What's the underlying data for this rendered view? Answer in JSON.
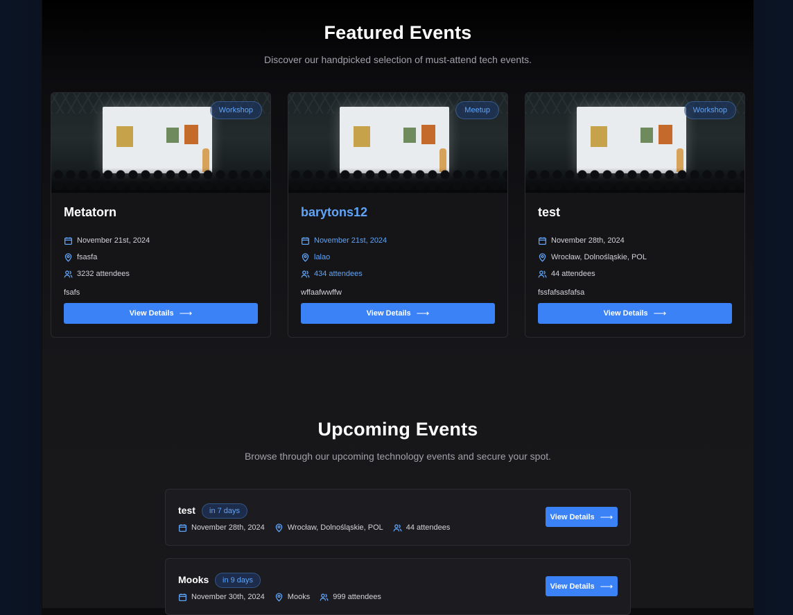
{
  "featured": {
    "title": "Featured Events",
    "subtitle": "Discover our handpicked selection of must-attend tech events.",
    "cards": [
      {
        "badge": "Workshop",
        "title": "Metatorn",
        "date": "November 21st, 2024",
        "location": "fsasfa",
        "attendees": "3232 attendees",
        "description": "fsafs",
        "button": "View Details",
        "highlight": false
      },
      {
        "badge": "Meetup",
        "title": "barytons12",
        "date": "November 21st, 2024",
        "location": "lalao",
        "attendees": "434 attendees",
        "description": "wffaafwwffw",
        "button": "View Details",
        "highlight": true
      },
      {
        "badge": "Workshop",
        "title": "test",
        "date": "November 28th, 2024",
        "location": "Wrocław, Dolnośląskie, POL",
        "attendees": "44 attendees",
        "description": "fssfafsasfafsa",
        "button": "View Details",
        "highlight": false
      }
    ]
  },
  "upcoming": {
    "title": "Upcoming Events",
    "subtitle": "Browse through our upcoming technology events and secure your spot.",
    "rows": [
      {
        "title": "test",
        "badge": "in 7 days",
        "date": "November 28th, 2024",
        "location": "Wrocław, Dolnośląskie, POL",
        "attendees": "44 attendees",
        "button": "View Details"
      },
      {
        "title": "Mooks",
        "badge": "in 9 days",
        "date": "November 30th, 2024",
        "location": "Mooks",
        "attendees": "999 attendees",
        "button": "View Details"
      }
    ]
  },
  "icons": {
    "date": "calendar-icon",
    "location": "map-pin-icon",
    "attendees": "users-icon",
    "button": "arrow-right-icon"
  },
  "colors": {
    "accent": "#3b82f6",
    "accent_text": "#60a5fa",
    "background": "#0c0c0e"
  }
}
